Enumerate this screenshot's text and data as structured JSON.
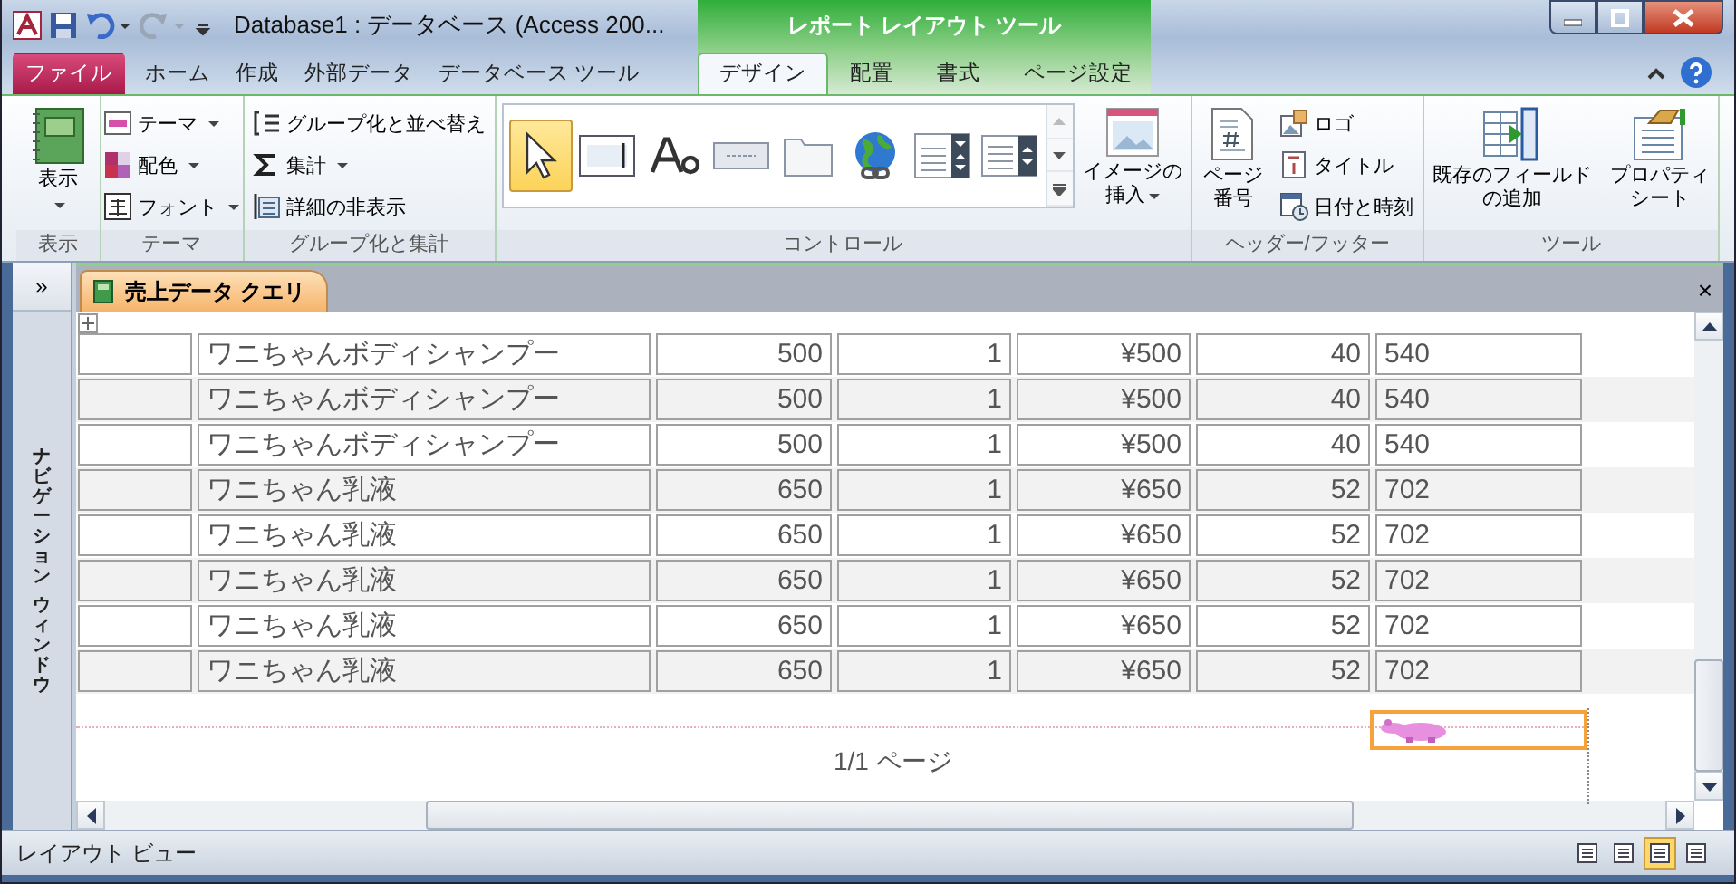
{
  "window": {
    "title": "Database1 : データベース (Access 200...",
    "context_title": "レポート レイアウト ツール"
  },
  "tabs": [
    {
      "label": "ファイル",
      "kind": "file",
      "selected": false
    },
    {
      "label": "ホーム",
      "kind": "core",
      "selected": false
    },
    {
      "label": "作成",
      "kind": "core",
      "selected": false
    },
    {
      "label": "外部データ",
      "kind": "core",
      "selected": false
    },
    {
      "label": "データベース ツール",
      "kind": "core",
      "selected": false
    },
    {
      "label": "デザイン",
      "kind": "context",
      "selected": true
    },
    {
      "label": "配置",
      "kind": "context",
      "selected": false
    },
    {
      "label": "書式",
      "kind": "context",
      "selected": false
    },
    {
      "label": "ページ設定",
      "kind": "context",
      "selected": false
    }
  ],
  "ribbon_groups": [
    {
      "label": "表示",
      "buttons": [
        {
          "label": "表示",
          "kind": "large",
          "dropdown": true
        }
      ]
    },
    {
      "label": "テーマ",
      "buttons": [
        {
          "label": "テーマ",
          "kind": "small",
          "dropdown": true
        },
        {
          "label": "配色",
          "kind": "small",
          "dropdown": true
        },
        {
          "label": "フォント",
          "kind": "small",
          "dropdown": true
        }
      ]
    },
    {
      "label": "グループ化と集計",
      "buttons": [
        {
          "label": "グループ化と並べ替え",
          "kind": "small",
          "dropdown": false
        },
        {
          "label": "集計",
          "kind": "small",
          "dropdown": true
        },
        {
          "label": "詳細の非表示",
          "kind": "small",
          "dropdown": false
        }
      ]
    },
    {
      "label": "コントロール",
      "buttons": [
        {
          "kind": "gallery",
          "controls": [
            {
              "selected": true
            },
            {
              "selected": false
            },
            {
              "selected": false
            },
            {
              "selected": false
            },
            {
              "selected": false
            },
            {
              "selected": false
            },
            {
              "selected": false
            },
            {
              "selected": false
            }
          ]
        },
        {
          "label": "イメージの挿入",
          "kind": "large",
          "dropdown": true
        }
      ]
    },
    {
      "label": "ヘッダー/フッター",
      "buttons": [
        {
          "label": "ページ番号",
          "kind": "large",
          "dropdown": false
        },
        {
          "label": "ロゴ",
          "kind": "small",
          "dropdown": false
        },
        {
          "label": "タイトル",
          "kind": "small",
          "dropdown": false
        },
        {
          "label": "日付と時刻",
          "kind": "small",
          "dropdown": false
        }
      ]
    },
    {
      "label": "ツール",
      "buttons": [
        {
          "label": "既存のフィールドの追加",
          "kind": "large",
          "dropdown": false
        },
        {
          "label": "プロパティシート",
          "kind": "large",
          "dropdown": false
        }
      ]
    }
  ],
  "navigation_pane": {
    "toggle": "»",
    "label_words": [
      "ナビゲーション",
      "ウィンドウ"
    ]
  },
  "document": {
    "tab": "売上データ クエリ",
    "close": "×",
    "rows": [
      {
        "cells": [
          "ワニちゃんボディシャンプー",
          "500",
          "1",
          "¥500",
          "40",
          "540"
        ]
      },
      {
        "cells": [
          "ワニちゃんボディシャンプー",
          "500",
          "1",
          "¥500",
          "40",
          "540"
        ]
      },
      {
        "cells": [
          "ワニちゃんボディシャンプー",
          "500",
          "1",
          "¥500",
          "40",
          "540"
        ]
      },
      {
        "cells": [
          "ワニちゃん乳液",
          "650",
          "1",
          "¥650",
          "52",
          "702"
        ]
      },
      {
        "cells": [
          "ワニちゃん乳液",
          "650",
          "1",
          "¥650",
          "52",
          "702"
        ]
      },
      {
        "cells": [
          "ワニちゃん乳液",
          "650",
          "1",
          "¥650",
          "52",
          "702"
        ]
      },
      {
        "cells": [
          "ワニちゃん乳液",
          "650",
          "1",
          "¥650",
          "52",
          "702"
        ]
      },
      {
        "cells": [
          "ワニちゃん乳液",
          "650",
          "1",
          "¥650",
          "52",
          "702"
        ]
      }
    ],
    "page_label": "1/1 ページ"
  },
  "status_bar": {
    "text": "レイアウト ビュー",
    "views": [
      {
        "selected": false
      },
      {
        "selected": false
      },
      {
        "selected": true
      },
      {
        "selected": false
      }
    ]
  }
}
